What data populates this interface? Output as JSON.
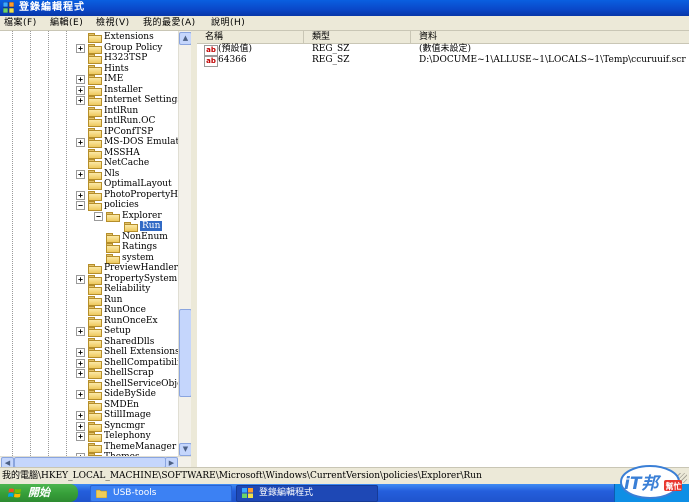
{
  "window": {
    "title": "登錄編輯程式",
    "icon": "registry-editor-icon"
  },
  "menu": [
    "檔案(F)",
    "編輯(E)",
    "檢視(V)",
    "我的最愛(A)",
    "說明(H)"
  ],
  "tree": {
    "items": [
      {
        "label": "Extensions",
        "expander": "none"
      },
      {
        "label": "Group Policy",
        "expander": "+"
      },
      {
        "label": "H323TSP",
        "expander": "none"
      },
      {
        "label": "Hints",
        "expander": "none"
      },
      {
        "label": "IME",
        "expander": "+"
      },
      {
        "label": "Installer",
        "expander": "+"
      },
      {
        "label": "Internet Settings",
        "expander": "+"
      },
      {
        "label": "IntlRun",
        "expander": "none"
      },
      {
        "label": "IntlRun.OC",
        "expander": "none"
      },
      {
        "label": "IPConfTSP",
        "expander": "none"
      },
      {
        "label": "MS-DOS Emulat",
        "expander": "+"
      },
      {
        "label": "MSSHA",
        "expander": "none"
      },
      {
        "label": "NetCache",
        "expander": "none"
      },
      {
        "label": "Nls",
        "expander": "+"
      },
      {
        "label": "OptimalLayout",
        "expander": "none"
      },
      {
        "label": "PhotoPropertyHa",
        "expander": "+"
      },
      {
        "label": "policies",
        "expander": "-"
      },
      {
        "label": "Explorer",
        "expander": "-"
      },
      {
        "label": "Run",
        "expander": "none",
        "selected": true
      },
      {
        "label": "NonEnum",
        "expander": "none"
      },
      {
        "label": "Ratings",
        "expander": "none"
      },
      {
        "label": "system",
        "expander": "none"
      },
      {
        "label": "PreviewHandlers",
        "expander": "none"
      },
      {
        "label": "PropertySystem",
        "expander": "+"
      },
      {
        "label": "Reliability",
        "expander": "none"
      },
      {
        "label": "Run",
        "expander": "none"
      },
      {
        "label": "RunOnce",
        "expander": "none"
      },
      {
        "label": "RunOnceEx",
        "expander": "none"
      },
      {
        "label": "Setup",
        "expander": "+"
      },
      {
        "label": "SharedDlls",
        "expander": "none"
      },
      {
        "label": "Shell Extensions",
        "expander": "+"
      },
      {
        "label": "ShellCompatibili",
        "expander": "+"
      },
      {
        "label": "ShellScrap",
        "expander": "+"
      },
      {
        "label": "ShellServiceObje",
        "expander": "none"
      },
      {
        "label": "SideBySide",
        "expander": "+"
      },
      {
        "label": "SMDEn",
        "expander": "none"
      },
      {
        "label": "StillImage",
        "expander": "+"
      },
      {
        "label": "Syncmgr",
        "expander": "+"
      },
      {
        "label": "Telephony",
        "expander": "+"
      },
      {
        "label": "ThemeManager",
        "expander": "none"
      },
      {
        "label": "Themes",
        "expander": "+"
      }
    ]
  },
  "list": {
    "columns": [
      "名稱",
      "類型",
      "資料"
    ],
    "rows": [
      {
        "icon": "string-value-icon",
        "name": "(預設值)",
        "type": "REG_SZ",
        "data": "(數值未設定)"
      },
      {
        "icon": "string-value-icon",
        "name": "64366",
        "type": "REG_SZ",
        "data": "D:\\DOCUME~1\\ALLUSE~1\\LOCALS~1\\Temp\\ccuruuif.scr"
      }
    ]
  },
  "status": {
    "path": "我的電腦\\HKEY_LOCAL_MACHINE\\SOFTWARE\\Microsoft\\Windows\\CurrentVersion\\policies\\Explorer\\Run"
  },
  "taskbar": {
    "start_label": "開始",
    "tasks": [
      "USB-tools",
      "登錄編輯程式"
    ],
    "active_task": 1
  },
  "watermark": {
    "brand": "iT邦",
    "sub": "幫忙"
  },
  "colors": {
    "titlebar": "#0a47c8",
    "selection": "#316ac5",
    "taskbar": "#245edc",
    "start": "#37a03a"
  }
}
